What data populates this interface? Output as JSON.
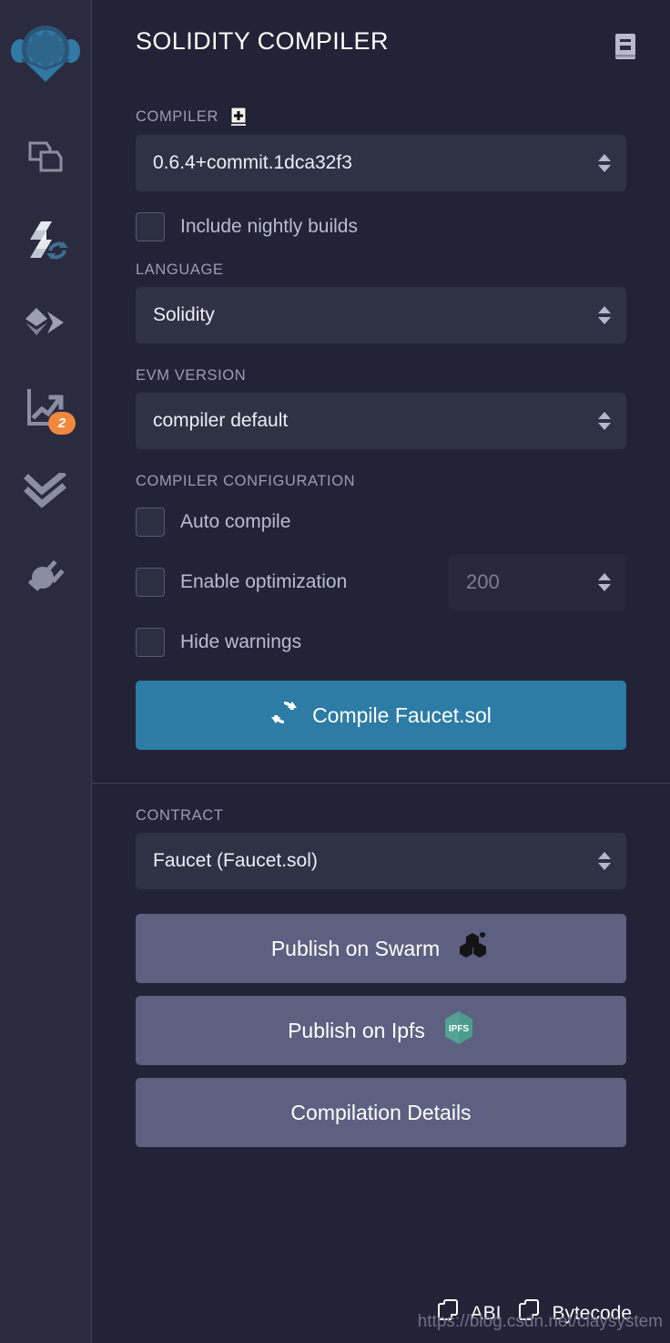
{
  "sidebar": {
    "logo": "remix-logo",
    "items": [
      {
        "name": "file-explorers",
        "icon": "files-icon",
        "badge": null
      },
      {
        "name": "solidity-compiler",
        "icon": "solidity-compile-icon",
        "badge": null,
        "active": true
      },
      {
        "name": "deploy-run-transactions",
        "icon": "ethereum-deploy-icon",
        "badge": null
      },
      {
        "name": "solidity-static-analysis",
        "icon": "analysis-chart-icon",
        "badge": "2"
      },
      {
        "name": "solidity-unit-testing",
        "icon": "double-check-icon",
        "badge": null
      },
      {
        "name": "plugin-manager",
        "icon": "plug-icon",
        "badge": null
      }
    ],
    "badge_color": "#f0883e"
  },
  "header": {
    "title": "SOLIDITY COMPILER",
    "doc_icon": "book-icon"
  },
  "compiler": {
    "label": "COMPILER",
    "add_icon": "add-custom-compiler-icon",
    "version": "0.6.4+commit.1dca32f3",
    "nightly": {
      "label": "Include nightly builds",
      "checked": false
    }
  },
  "language": {
    "label": "LANGUAGE",
    "value": "Solidity"
  },
  "evm": {
    "label": "EVM VERSION",
    "value": "compiler default"
  },
  "configuration": {
    "label": "COMPILER CONFIGURATION",
    "auto_compile": {
      "label": "Auto compile",
      "checked": false
    },
    "enable_optimization": {
      "label": "Enable optimization",
      "checked": false
    },
    "runs": {
      "value": "200",
      "disabled": true
    },
    "hide_warnings": {
      "label": "Hide warnings",
      "checked": false
    }
  },
  "compile_button": {
    "label": "Compile Faucet.sol",
    "icon": "sync-icon",
    "color": "#2d7ca5"
  },
  "contract": {
    "label": "CONTRACT",
    "value": "Faucet (Faucet.sol)"
  },
  "actions": [
    {
      "label": "Publish on Swarm",
      "icon": "swarm-cubes-icon"
    },
    {
      "label": "Publish on Ipfs",
      "icon": "ipfs-hex-icon"
    },
    {
      "label": "Compilation Details",
      "icon": null
    }
  ],
  "footer": {
    "abi": {
      "label": "ABI",
      "icon": "copy-icon"
    },
    "bytecode": {
      "label": "Bytecode",
      "icon": "copy-icon"
    },
    "watermark": "https://blog.csdn.net/claysystem"
  }
}
